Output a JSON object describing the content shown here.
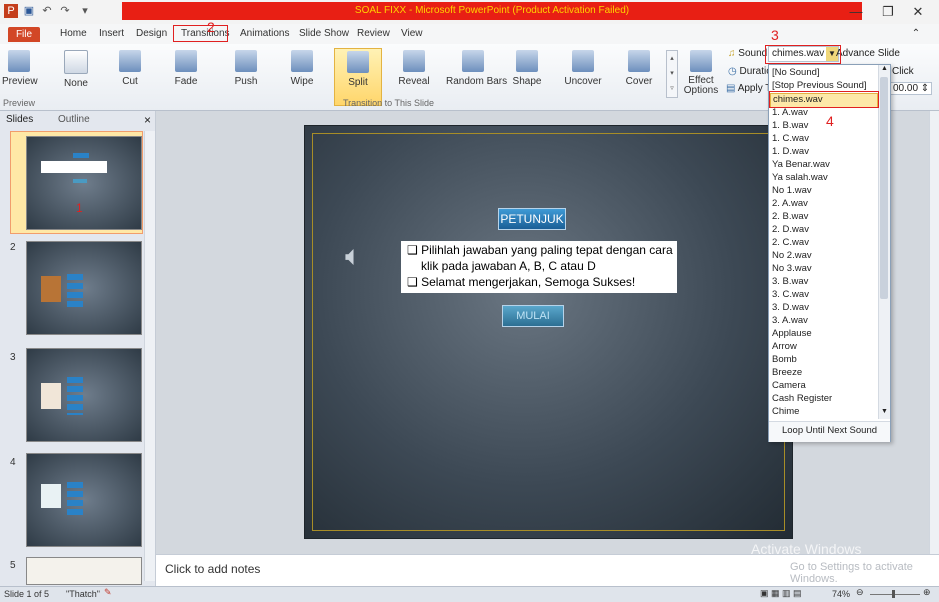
{
  "window": {
    "title": "SOAL FIXX - Microsoft PowerPoint (Product Activation Failed)",
    "controls": {
      "minimize": "—",
      "restore": "❐",
      "close": "✕"
    }
  },
  "menu": {
    "tabs": [
      "File",
      "Home",
      "Insert",
      "Design",
      "Transitions",
      "Animations",
      "Slide Show",
      "Review",
      "View"
    ]
  },
  "ribbon": {
    "preview_label": "Preview",
    "transitions": [
      "None",
      "Cut",
      "Fade",
      "Push",
      "Wipe",
      "Split",
      "Reveal",
      "Random Bars",
      "Shape",
      "Uncover",
      "Cover"
    ],
    "selected_transition": "Split",
    "effect_options_label": "Effect Options",
    "group_preview": "Preview",
    "group_transition": "Transition to This Slide",
    "sound_label": "Sound:",
    "sound_value": "chimes.wav",
    "advance_slide_label": "Advance Slide",
    "duration_label": "Duratio",
    "apply_label": "Apply To",
    "click_label": "Click",
    "after_value": "00.00"
  },
  "annotations": {
    "n2": "2",
    "n3": "3",
    "n4": "4",
    "n1": "1"
  },
  "slides_panel": {
    "tab_slides": "Slides",
    "tab_outline": "Outline",
    "close": "×",
    "numbers": [
      "1",
      "2",
      "3",
      "4",
      "5"
    ]
  },
  "slide": {
    "heading": "PETUNJUK",
    "line1": "❑  Pilihlah jawaban yang paling tepat dengan cara",
    "line2": "klik pada jawaban A, B, C  atau D",
    "line3": "❑  Selamat mengerjakan, Semoga Sukses!",
    "button": "MULAI"
  },
  "notes": {
    "placeholder": "Click to add notes"
  },
  "dropdown": {
    "items": [
      "[No Sound]",
      "[Stop Previous Sound]",
      "chimes.wav",
      "1. A.wav",
      "1. B.wav",
      "1. C.wav",
      "1. D.wav",
      "Ya Benar.wav",
      "Ya salah.wav",
      "No 1.wav",
      "2. A.wav",
      "2. B.wav",
      "2. D.wav",
      "2. C.wav",
      "No 2.wav",
      "No 3.wav",
      "3. B.wav",
      "3. C.wav",
      "3. D.wav",
      "3. A.wav",
      "Applause",
      "Arrow",
      "Bomb",
      "Breeze",
      "Camera",
      "Cash Register",
      "Chime"
    ],
    "selected": "chimes.wav",
    "footer": "Loop Until Next Sound"
  },
  "watermark": {
    "line1": "Activate Windows",
    "line2": "Go to Settings to activate Windows."
  },
  "status": {
    "slide_info": "Slide 1 of 5",
    "theme": "\"Thatch\"",
    "zoom": "74%"
  }
}
